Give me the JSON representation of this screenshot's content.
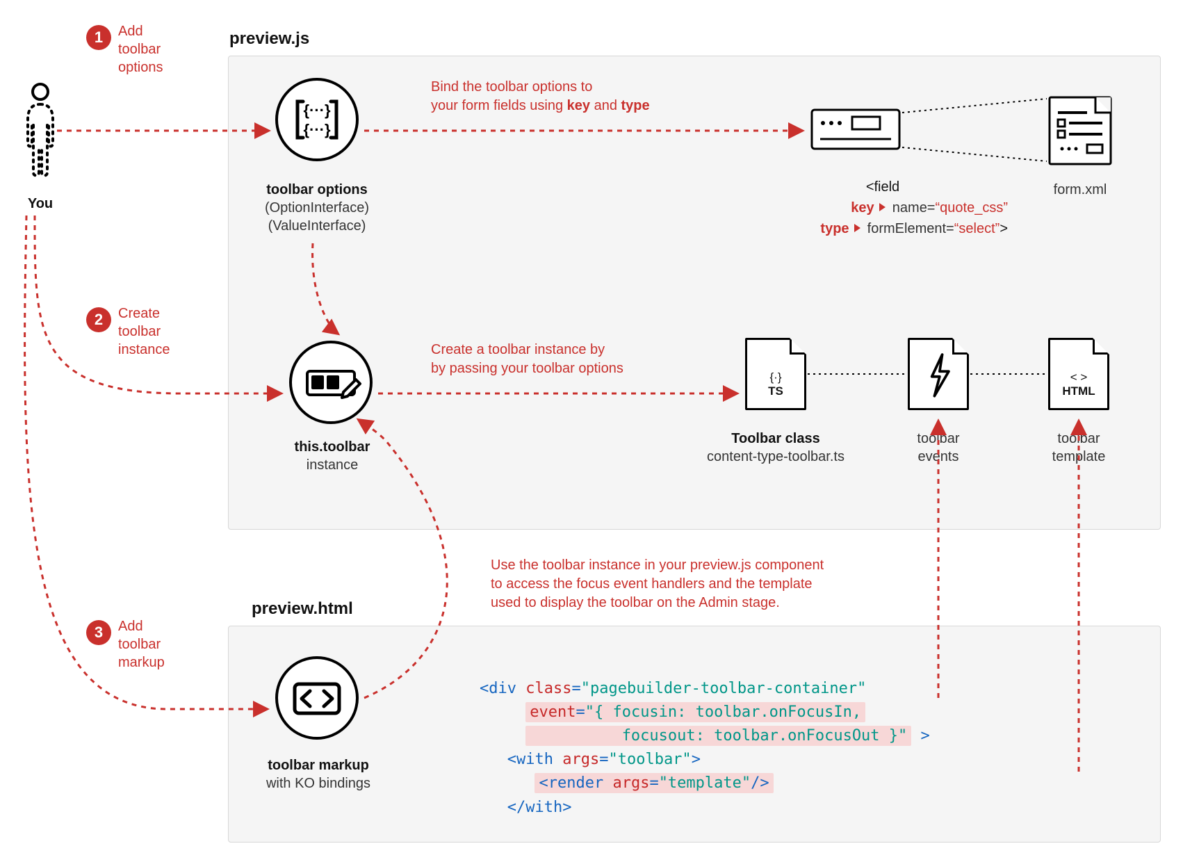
{
  "actor": {
    "label": "You"
  },
  "steps": {
    "s1": {
      "num": "1",
      "line1": "Add",
      "line2": "toolbar",
      "line3": "options"
    },
    "s2": {
      "num": "2",
      "line1": "Create",
      "line2": "toolbar",
      "line3": "instance"
    },
    "s3": {
      "num": "3",
      "line1": "Add",
      "line2": "toolbar",
      "line3": "markup"
    }
  },
  "panels": {
    "preview_js": "preview.js",
    "preview_html": "preview.html"
  },
  "nodes": {
    "options": {
      "title": "toolbar options",
      "sub1": "(OptionInterface)",
      "sub2": "(ValueInterface)"
    },
    "instance": {
      "title": "this.toolbar",
      "sub": "instance"
    },
    "markup": {
      "title": "toolbar markup",
      "sub": "with KO bindings"
    },
    "toolbar_class": {
      "title": "Toolbar class",
      "sub": "content-type-toolbar.ts",
      "badge_top": "{·}",
      "badge_bottom": "TS"
    },
    "toolbar_events": {
      "title": "toolbar",
      "sub": "events"
    },
    "toolbar_template": {
      "title": "toolbar",
      "sub": "template",
      "badge_top": "< >",
      "badge_bottom": "HTML"
    },
    "form_xml": {
      "title": "form.xml"
    }
  },
  "notes": {
    "bind": {
      "pre": "Bind the toolbar options to",
      "post_pre": "your form fields using ",
      "k1": "key",
      "mid": " and ",
      "k2": "type"
    },
    "create": {
      "l1": "Create a toolbar instance by",
      "l2": "by passing your toolbar options"
    },
    "use": {
      "l1": "Use the toolbar instance in your preview.js component",
      "l2": "to access the focus event handlers and the template",
      "l3": "used to display the toolbar on the Admin stage."
    }
  },
  "field": {
    "tag": "<field",
    "key_label": "key",
    "key_attr": "name=",
    "key_val": "“quote_css”",
    "type_label": "type",
    "type_attr": "formElement=",
    "type_val": "“select”",
    "close": ">"
  },
  "code": {
    "l1_a": "<div ",
    "l1_b": "class",
    "l1_c": "=",
    "l1_d": "\"pagebuilder-toolbar-container\"",
    "l2_a": "event",
    "l2_b": "=",
    "l2_c": "\"{ focusin: toolbar.onFocusIn,",
    "l3_a": "focusout: toolbar.onFocusOut }\"",
    "l3_b": " >",
    "l4_a": "<with ",
    "l4_b": "args",
    "l4_c": "=",
    "l4_d": "\"toolbar\"",
    "l4_e": ">",
    "l5_a": "<render ",
    "l5_b": "args",
    "l5_c": "=",
    "l5_d": "\"template\"",
    "l5_e": "/>",
    "l6": "</with>"
  }
}
